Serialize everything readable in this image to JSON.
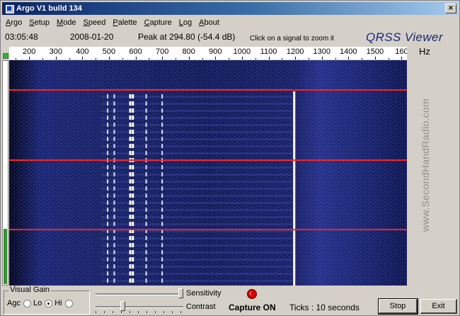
{
  "window": {
    "title": "Argo V1 build 134",
    "close_glyph": "×"
  },
  "menu": [
    "Argo",
    "Setup",
    "Mode",
    "Speed",
    "Palette",
    "Capture",
    "Log",
    "About"
  ],
  "info": {
    "time": "03:05:48",
    "date": "2008-01-20",
    "peak": "Peak at 294.80 (-54.4 dB)",
    "hint": "Click on a signal to zoom it",
    "logo": "QRSS Viewer"
  },
  "spectrum": {
    "unit": "Hz",
    "tick_labels": [
      "200",
      "300",
      "400",
      "500",
      "600",
      "700",
      "800",
      "900",
      "1000",
      "1100",
      "1200",
      "1300",
      "1400",
      "1500",
      "160"
    ],
    "tick_values_hz": [
      200,
      300,
      400,
      500,
      600,
      700,
      800,
      900,
      1000,
      1100,
      1200,
      1300,
      1400,
      1500,
      1600
    ],
    "freq_start_hz": 125,
    "freq_end_hz": 1620,
    "watermark": "www.SecondHandRadio.com",
    "signal_hz": [
      495,
      520,
      580,
      590,
      640,
      700,
      1195
    ],
    "level_fraction": 0.25,
    "colors": {
      "background": "#0a0c3a",
      "trace": "#ffffff",
      "marker_line": "#ff2020",
      "level": "#20a020"
    }
  },
  "controls": {
    "visual_gain": {
      "title": "Visual Gain",
      "agc": "Agc",
      "lo": "Lo",
      "hi": "Hi",
      "selected": "Lo"
    },
    "sensitivity_label": "Sensitivity",
    "contrast_label": "Contrast",
    "sensitivity_value": 1.0,
    "contrast_value": 0.3,
    "capture_status": "Capture ON",
    "ticks": "Ticks   : 10 seconds",
    "stop_label": "Stop",
    "exit_label": "Exit"
  }
}
